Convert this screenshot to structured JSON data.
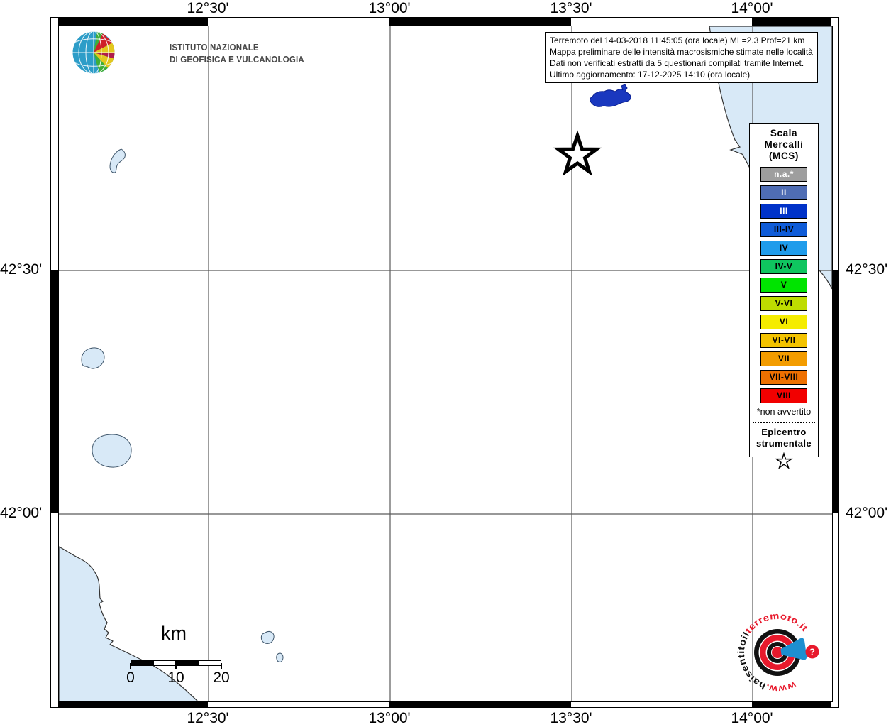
{
  "axes": {
    "top": [
      "12°30'",
      "13°00'",
      "13°30'",
      "14°00'"
    ],
    "bottom": [
      "12°30'",
      "13°00'",
      "13°30'",
      "14°00'"
    ],
    "left": [
      "42°30'",
      "42°00'"
    ],
    "right": [
      "42°30'",
      "42°00'"
    ]
  },
  "logo": {
    "line1": "ISTITUTO NAZIONALE",
    "line2": "DI GEOFISICA E VULCANOLOGIA"
  },
  "info_box": {
    "lines": [
      "Terremoto del 14-03-2018 11:45:05 (ora locale) ML=2.3 Prof=21 km",
      "Mappa preliminare delle intensità macrosismiche stimate nelle località",
      "Dati non verificati estratti da 5 questionari compilati tramite Internet.",
      "Ultimo aggiornamento: 17-12-2025 14:10 (ora locale)"
    ]
  },
  "legend": {
    "title": "Scala\nMercalli\n(MCS)",
    "items": [
      {
        "label": "n.a.*",
        "color": "#9e9e9e",
        "text_color": "#ffffff"
      },
      {
        "label": "II",
        "color": "#4f6db4",
        "text_color": "#ffffff"
      },
      {
        "label": "III",
        "color": "#0032c8",
        "text_color": "#ffffff"
      },
      {
        "label": "III-IV",
        "color": "#0f5cd8",
        "text_color": "#000000"
      },
      {
        "label": "IV",
        "color": "#1f9ceb",
        "text_color": "#000000"
      },
      {
        "label": "IV-V",
        "color": "#0fc55f",
        "text_color": "#000000"
      },
      {
        "label": "V",
        "color": "#00e400",
        "text_color": "#000000"
      },
      {
        "label": "V-VI",
        "color": "#bedc00",
        "text_color": "#000000"
      },
      {
        "label": "VI",
        "color": "#f5ec00",
        "text_color": "#000000"
      },
      {
        "label": "VI-VII",
        "color": "#f3c300",
        "text_color": "#000000"
      },
      {
        "label": "VII",
        "color": "#f39c00",
        "text_color": "#000000"
      },
      {
        "label": "VII-VIII",
        "color": "#ee7000",
        "text_color": "#000000"
      },
      {
        "label": "VIII",
        "color": "#f20000",
        "text_color": "#000000"
      }
    ],
    "footnote": "*non avvertito",
    "epicenter_label": "Epicentro\nstrumentale"
  },
  "scale_bar": {
    "unit": "km",
    "ticks": [
      "0",
      "10",
      "20"
    ]
  },
  "watermark": {
    "url_prefix": "www.",
    "url_middle": "haisentitoil",
    "url_suffix": "terremoto.it",
    "question_mark": "?"
  },
  "colors": {
    "sea": "#d8e9f7",
    "coast": "#333333",
    "lake_outline": "#3f566b",
    "lake_dark": "#1a38bf",
    "grid": "#5a5a5a"
  }
}
